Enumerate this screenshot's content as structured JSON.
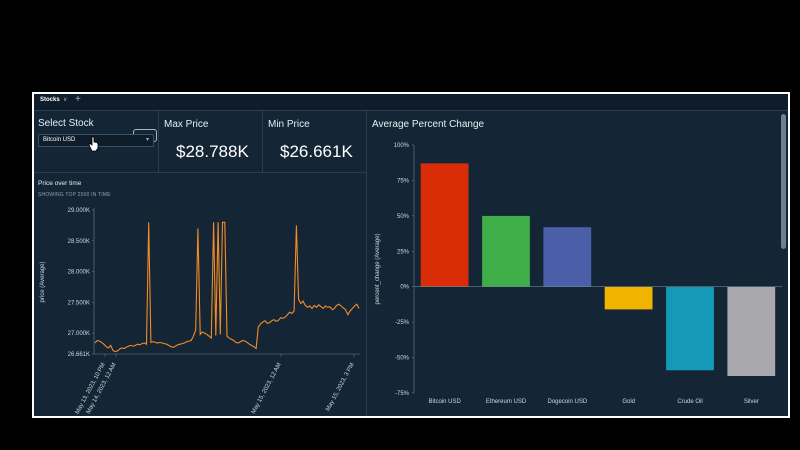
{
  "tabs": {
    "active_label": "Stocks",
    "add_label": "+"
  },
  "select_stock": {
    "title": "Select Stock",
    "value": "Bitcoin USD"
  },
  "max_price": {
    "title": "Max Price",
    "value": "$28.788K"
  },
  "min_price": {
    "title": "Min Price",
    "value": "$26.661K"
  },
  "colors": {
    "background": "#142535",
    "line": "#f28c28"
  },
  "chart_data": [
    {
      "type": "line",
      "title": "Price over time",
      "subtitle": "SHOWING TOP 2500 IN TIME",
      "ylabel": "price (Average)",
      "xlabel": "",
      "ylim": [
        26.661,
        29.0
      ],
      "y_ticks": [
        "29.000K",
        "28.500K",
        "28.000K",
        "27.500K",
        "27.000K",
        "26.661K"
      ],
      "x_tick_labels": [
        "May 13, 2023, 10 PM",
        "May 14, 2023, 12 AM",
        "May 15, 2023, 12 AM",
        "May 15, 2023, 3 PM"
      ],
      "series": [
        {
          "values": [
            26.84,
            26.88,
            26.87,
            26.85,
            26.82,
            26.78,
            26.76,
            26.8,
            26.72,
            26.7,
            26.71,
            26.74,
            26.76,
            26.75,
            26.77,
            26.79,
            26.8,
            26.79,
            26.8,
            26.82,
            26.81,
            26.83,
            26.84,
            26.82,
            28.8,
            26.85,
            26.86,
            26.85,
            26.84,
            26.85,
            26.84,
            26.83,
            26.82,
            26.8,
            26.78,
            26.77,
            26.79,
            26.81,
            26.82,
            26.83,
            26.84,
            26.86,
            26.87,
            26.88,
            26.95,
            27.05,
            28.7,
            26.98,
            27.02,
            27.0,
            26.98,
            26.95,
            26.92,
            28.8,
            26.96,
            28.8,
            26.98,
            28.8,
            28.8,
            26.95,
            26.92,
            26.9,
            26.88,
            26.85,
            26.84,
            26.86,
            26.88,
            26.87,
            26.85,
            26.82,
            26.8,
            26.78,
            26.75,
            27.1,
            27.15,
            27.18,
            27.2,
            27.16,
            27.17,
            27.2,
            27.22,
            27.19,
            27.21,
            27.25,
            27.24,
            27.26,
            27.3,
            27.34,
            27.32,
            27.36,
            28.75,
            27.55,
            27.48,
            27.52,
            27.45,
            27.42,
            27.44,
            27.4,
            27.45,
            27.42,
            27.46,
            27.43,
            27.4,
            27.44,
            27.42,
            27.43,
            27.38,
            27.4,
            27.45,
            27.47,
            27.44,
            27.41,
            27.38,
            27.3,
            27.36,
            27.4,
            27.44,
            27.47,
            27.4
          ]
        }
      ]
    },
    {
      "type": "bar",
      "title": "Average Percent Change",
      "ylabel": "percent_change (Average)",
      "xlabel": "",
      "ylim": [
        -75,
        100
      ],
      "y_ticks": [
        "100%",
        "75%",
        "50%",
        "25%",
        "0%",
        "-25%",
        "-50%",
        "-75%"
      ],
      "categories": [
        "Bitcoin USD",
        "Ethereum USD",
        "Dogecoin USD",
        "Gold",
        "Crude Oil",
        "Silver"
      ],
      "values": [
        87,
        50,
        42,
        -16,
        -59,
        -63
      ],
      "colors": [
        "#d92d07",
        "#3fae49",
        "#4a5fa8",
        "#f0b400",
        "#1499b8",
        "#a9a9ad"
      ]
    }
  ]
}
